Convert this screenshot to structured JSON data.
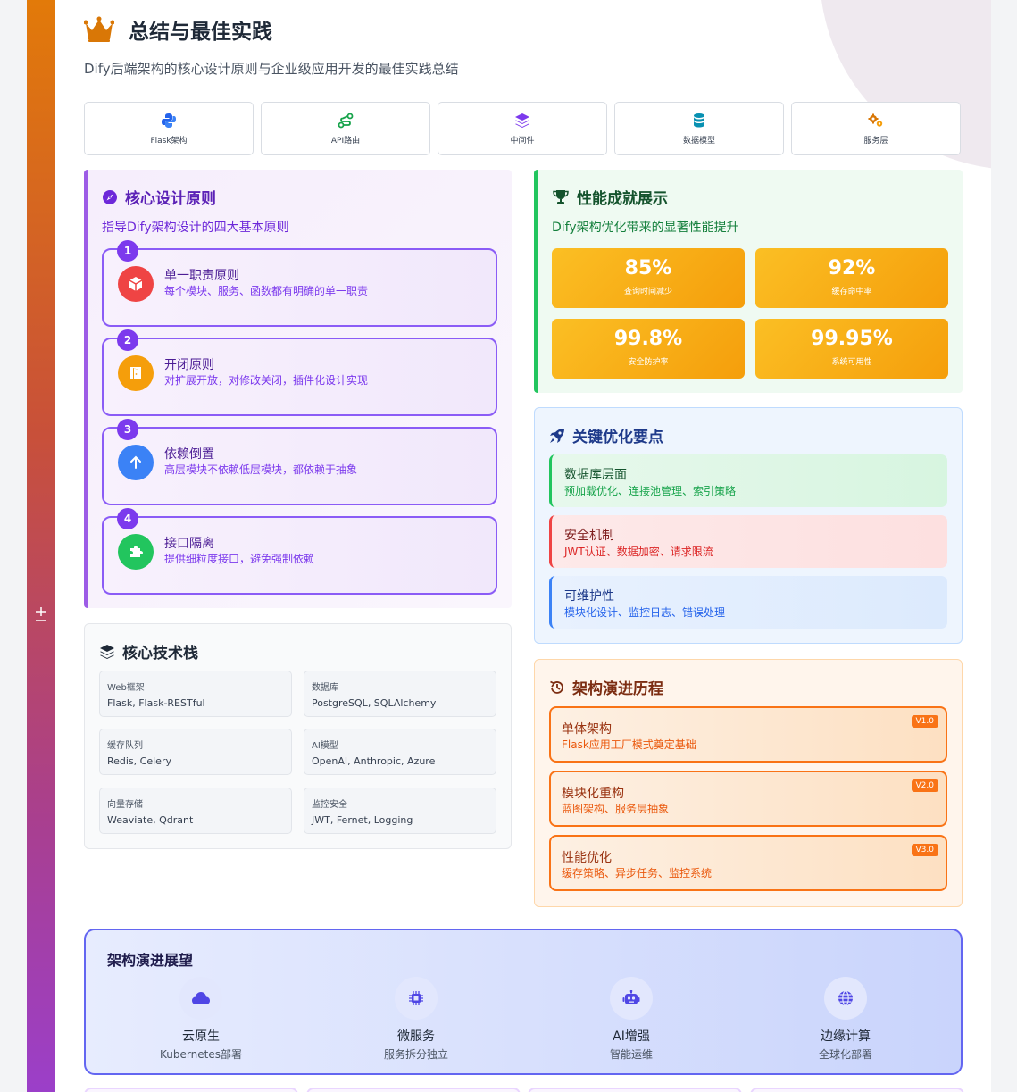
{
  "header": {
    "title": "总结与最佳实践",
    "subtitle": "Dify后端架构的核心设计原则与企业级应用开发的最佳实践总结"
  },
  "sidebar": {
    "toggle_glyph": "± "
  },
  "nav_pills": [
    {
      "label": "Flask架构",
      "icon": "python-icon",
      "color": "#2563eb"
    },
    {
      "label": "API路由",
      "icon": "route-icon",
      "color": "#16a34a"
    },
    {
      "label": "中间件",
      "icon": "layers-icon",
      "color": "#7c3aed"
    },
    {
      "label": "数据模型",
      "icon": "database-icon",
      "color": "#0891b2"
    },
    {
      "label": "服务层",
      "icon": "gears-icon",
      "color": "#d97706"
    }
  ],
  "principles": {
    "title": "核心设计原则",
    "subtitle": "指导Dify架构设计的四大基本原则",
    "items": [
      {
        "num": "1",
        "title": "单一职责原则",
        "desc": "每个模块、服务、函数都有明确的单一职责",
        "icon": "cube-icon",
        "color": "#ef4444"
      },
      {
        "num": "2",
        "title": "开闭原则",
        "desc": "对扩展开放，对修改关闭，插件化设计实现",
        "icon": "door-open-icon",
        "color": "#f59e0b"
      },
      {
        "num": "3",
        "title": "依赖倒置",
        "desc": "高层模块不依赖低层模块，都依赖于抽象",
        "icon": "arrow-up-icon",
        "color": "#3b82f6"
      },
      {
        "num": "4",
        "title": "接口隔离",
        "desc": "提供细粒度接口，避免强制依赖",
        "icon": "puzzle-icon",
        "color": "#22c55e"
      }
    ]
  },
  "tech_stack": {
    "title": "核心技术栈",
    "items": [
      {
        "key": "Web框架",
        "value": "Flask, Flask-RESTful"
      },
      {
        "key": "数据库",
        "value": "PostgreSQL, SQLAlchemy"
      },
      {
        "key": "缓存队列",
        "value": "Redis, Celery"
      },
      {
        "key": "AI模型",
        "value": "OpenAI, Anthropic, Azure"
      },
      {
        "key": "向量存储",
        "value": "Weaviate, Qdrant"
      },
      {
        "key": "监控安全",
        "value": "JWT, Fernet, Logging"
      }
    ]
  },
  "performance": {
    "title": "性能成就展示",
    "subtitle": "Dify架构优化带来的显著性能提升",
    "stats": [
      {
        "value": "85%",
        "label": "查询时间减少"
      },
      {
        "value": "92%",
        "label": "缓存命中率"
      },
      {
        "value": "99.8%",
        "label": "安全防护率"
      },
      {
        "value": "99.95%",
        "label": "系统可用性"
      }
    ]
  },
  "key_points": {
    "title": "关键优化要点",
    "items": [
      {
        "title": "数据库层面",
        "desc": "预加载优化、连接池管理、索引策略",
        "color": "#16a34a"
      },
      {
        "title": "安全机制",
        "desc": "JWT认证、数据加密、请求限流",
        "color": "#dc2626"
      },
      {
        "title": "可维护性",
        "desc": "模块化设计、监控日志、错误处理",
        "color": "#2563eb"
      }
    ]
  },
  "evolution": {
    "title": "架构演进历程",
    "items": [
      {
        "title": "单体架构",
        "desc": "Flask应用工厂模式奠定基础",
        "badge": "V1.0"
      },
      {
        "title": "模块化重构",
        "desc": "蓝图架构、服务层抽象",
        "badge": "V2.0"
      },
      {
        "title": "性能优化",
        "desc": "缓存策略、异步任务、监控系统",
        "badge": "V3.0"
      }
    ]
  },
  "outlook": {
    "title": "架构演进展望",
    "items": [
      {
        "title": "云原生",
        "desc": "Kubernetes部署",
        "icon": "cloud-icon"
      },
      {
        "title": "微服务",
        "desc": "服务拆分独立",
        "icon": "chip-icon"
      },
      {
        "title": "AI增强",
        "desc": "智能运维",
        "icon": "robot-icon"
      },
      {
        "title": "边缘计算",
        "desc": "全球化部署",
        "icon": "globe-icon"
      }
    ]
  }
}
